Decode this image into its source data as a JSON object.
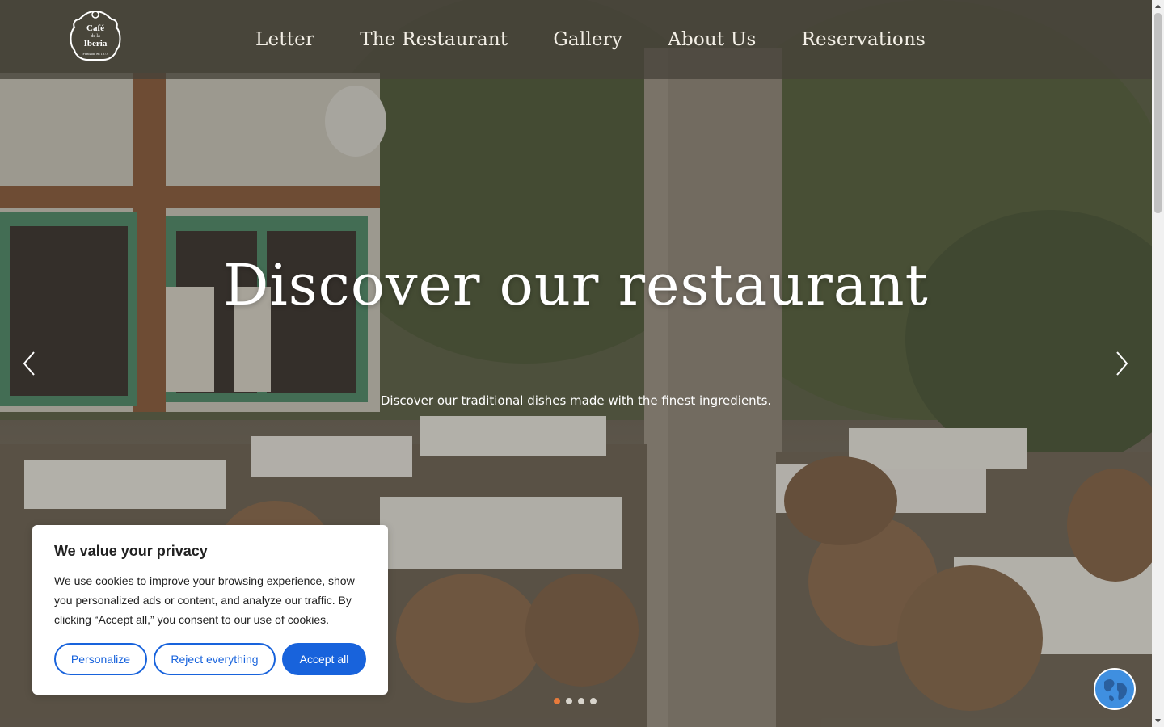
{
  "brand": {
    "logo_line1": "Café",
    "logo_line2": "de la",
    "logo_line3": "Iberia",
    "logo_tagline": "Fundado en 1873"
  },
  "nav": {
    "items": [
      {
        "label": "Letter"
      },
      {
        "label": "The Restaurant"
      },
      {
        "label": "Gallery"
      },
      {
        "label": "About Us"
      },
      {
        "label": "Reservations"
      }
    ]
  },
  "hero": {
    "title": "Discover our restaurant",
    "subtitle": "Discover our traditional dishes made with the finest ingredients.",
    "slides_total": 4,
    "active_slide": 1
  },
  "cookie": {
    "title": "We value your privacy",
    "text": "We use cookies to improve your browsing experience, show you personalized ads or content, and analyze our traffic. By clicking “Accept all,” you consent to our use of cookies.",
    "personalize_label": "Personalize",
    "reject_label": "Reject everything",
    "accept_label": "Accept all"
  },
  "colors": {
    "accent_blue": "#1863dc",
    "active_dot": "#e87a3b"
  },
  "icons": {
    "prev": "chevron-left-icon",
    "next": "chevron-right-icon",
    "language": "globe-icon"
  }
}
